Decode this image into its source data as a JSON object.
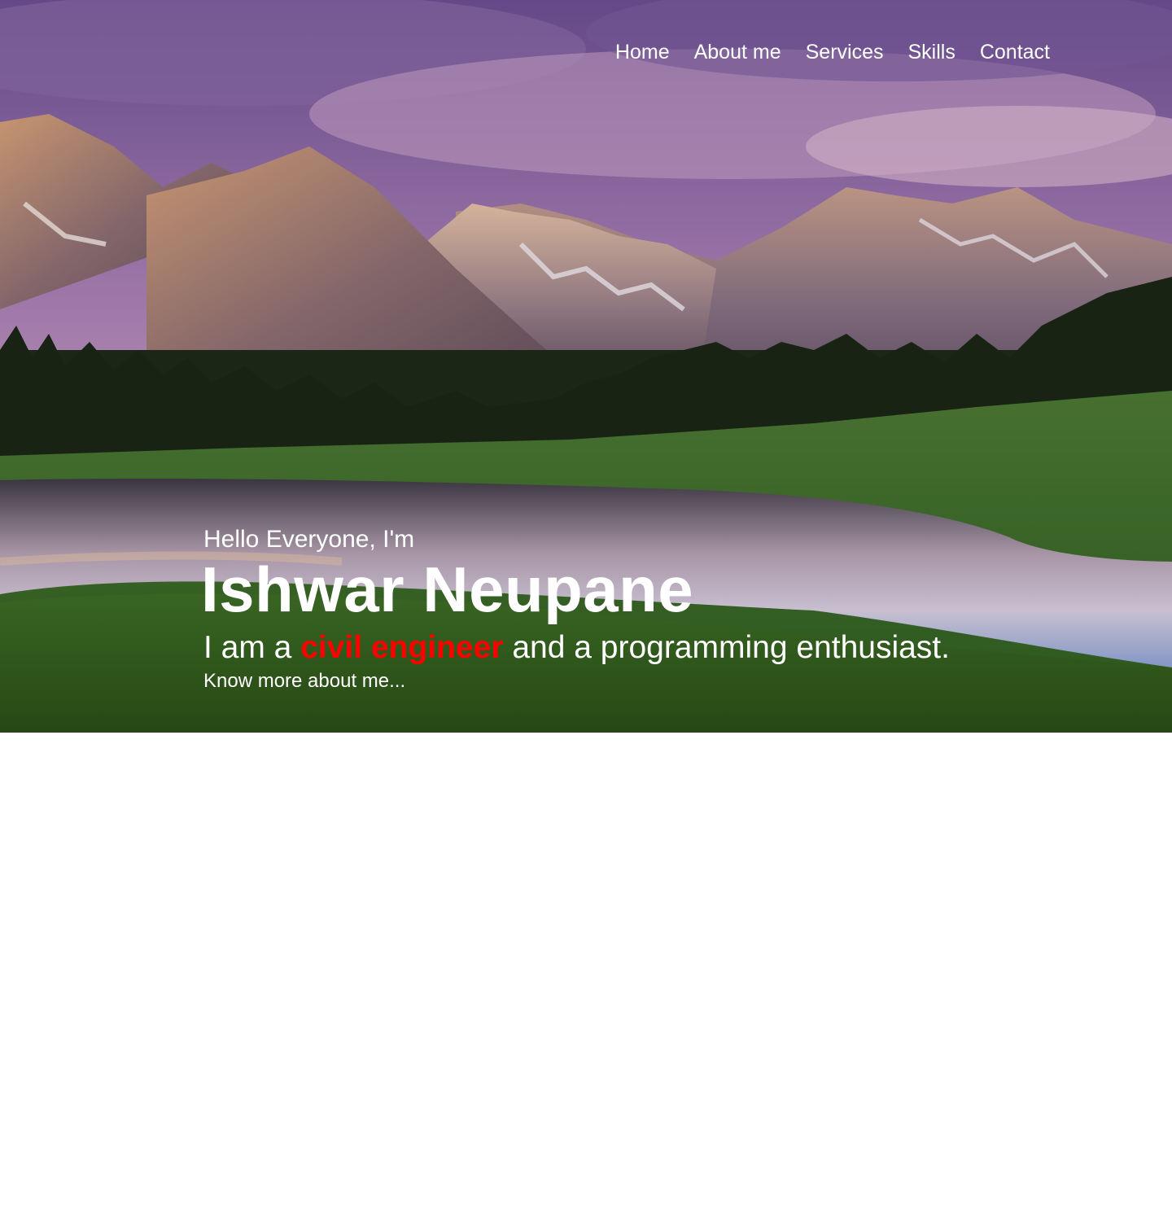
{
  "nav": {
    "items": [
      {
        "label": "Home"
      },
      {
        "label": "About me"
      },
      {
        "label": "Services"
      },
      {
        "label": "Skills"
      },
      {
        "label": "Contact"
      }
    ]
  },
  "hero": {
    "greeting": "Hello Everyone, I'm",
    "name": "Ishwar Neupane",
    "tagline_prefix": "I am a ",
    "tagline_accent": "civil engineer",
    "tagline_suffix": " and a programming enthusiast.",
    "more_link": "Know more about me...",
    "accent_color": "#ff0000",
    "text_color": "#ffffff"
  }
}
